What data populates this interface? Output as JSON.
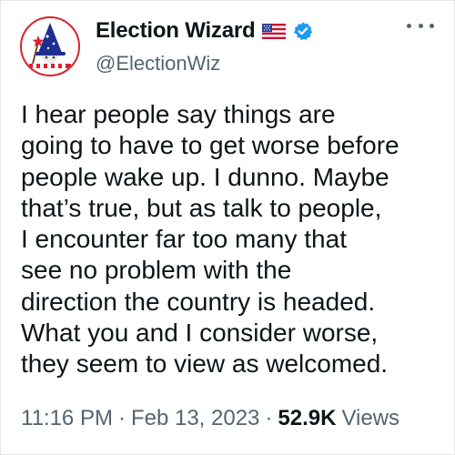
{
  "author": {
    "display_name": "Election Wizard",
    "handle": "@ElectionWiz",
    "avatar_icon": "wizard-avatar-icon",
    "flag_icon": "us-flag-icon",
    "verified_icon": "verified-badge-icon",
    "colors": {
      "verified": "#1d9bf0",
      "avatar_ring": "#d8232f",
      "wizard_hat": "#1e2f8f"
    }
  },
  "more_icon": "more-options-icon",
  "tweet": {
    "lines": [
      "I hear people say things are",
      "going to have to get worse before",
      "people wake up. I dunno. Maybe",
      "that’s true, but as talk to people,",
      "I encounter far too many that",
      "see no problem with the",
      "direction the country is headed.",
      "What you and I consider worse,",
      "they seem to view as welcomed."
    ]
  },
  "meta": {
    "time": "11:16 PM",
    "separator": "·",
    "date": "Feb 13, 2023",
    "views_count": "52.9K",
    "views_label": "Views"
  }
}
